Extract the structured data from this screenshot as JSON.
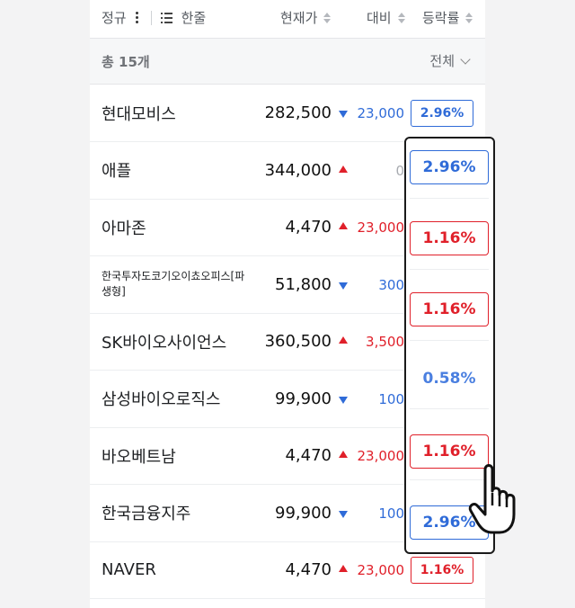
{
  "header": {
    "col_name": "정규",
    "view_toggle": "한줄",
    "col_price": "현재가",
    "col_change": "대비",
    "col_rate": "등락률"
  },
  "summary": {
    "count": "총 15개",
    "filter": "전체"
  },
  "rows": [
    {
      "name": "현대모비스",
      "price": "282,500",
      "dir": "down",
      "change": "23,000",
      "change_color": "blue",
      "rate": "2.96%",
      "rate_color": "blue"
    },
    {
      "name": "애플",
      "price": "344,000",
      "dir": "up",
      "change": "0",
      "change_color": "gray",
      "rate": "",
      "rate_color": "blue"
    },
    {
      "name": "아마존",
      "price": "4,470",
      "dir": "up",
      "change": "23,000",
      "change_color": "red",
      "rate": "",
      "rate_color": "red"
    },
    {
      "name": "한국투자도코기오이쵸오피스[파생형]",
      "price": "51,800",
      "dir": "down",
      "change": "300",
      "change_color": "blue",
      "rate": "",
      "rate_color": "blue"
    },
    {
      "name": "SK바이오사이언스",
      "price": "360,500",
      "dir": "up",
      "change": "3,500",
      "change_color": "red",
      "rate": "",
      "rate_color": "red"
    },
    {
      "name": "삼성바이오로직스",
      "price": "99,900",
      "dir": "down",
      "change": "100",
      "change_color": "blue",
      "rate": "",
      "rate_color": "blue"
    },
    {
      "name": "바오베트남",
      "price": "4,470",
      "dir": "up",
      "change": "23,000",
      "change_color": "red",
      "rate": "",
      "rate_color": "red"
    },
    {
      "name": "한국금융지주",
      "price": "99,900",
      "dir": "down",
      "change": "100",
      "change_color": "blue",
      "rate": "",
      "rate_color": "blue"
    },
    {
      "name": "NAVER",
      "price": "4,470",
      "dir": "up",
      "change": "23,000",
      "change_color": "red",
      "rate": "1.16%",
      "rate_color": "red"
    }
  ],
  "focus_rates": [
    {
      "value": "2.96%",
      "style": "blue"
    },
    {
      "value": "1.16%",
      "style": "red"
    },
    {
      "value": "1.16%",
      "style": "red"
    },
    {
      "value": "0.58%",
      "style": "plain"
    },
    {
      "value": "1.16%",
      "style": "red"
    },
    {
      "value": "2.96%",
      "style": "blue"
    }
  ],
  "colors": {
    "up": "#e0202a",
    "down": "#2f6bd8",
    "neutral": "#a8abb0"
  },
  "icons": [
    "more-vertical-icon",
    "list-icon",
    "sort-icon",
    "chevron-down-icon",
    "hand-pointer-icon"
  ]
}
